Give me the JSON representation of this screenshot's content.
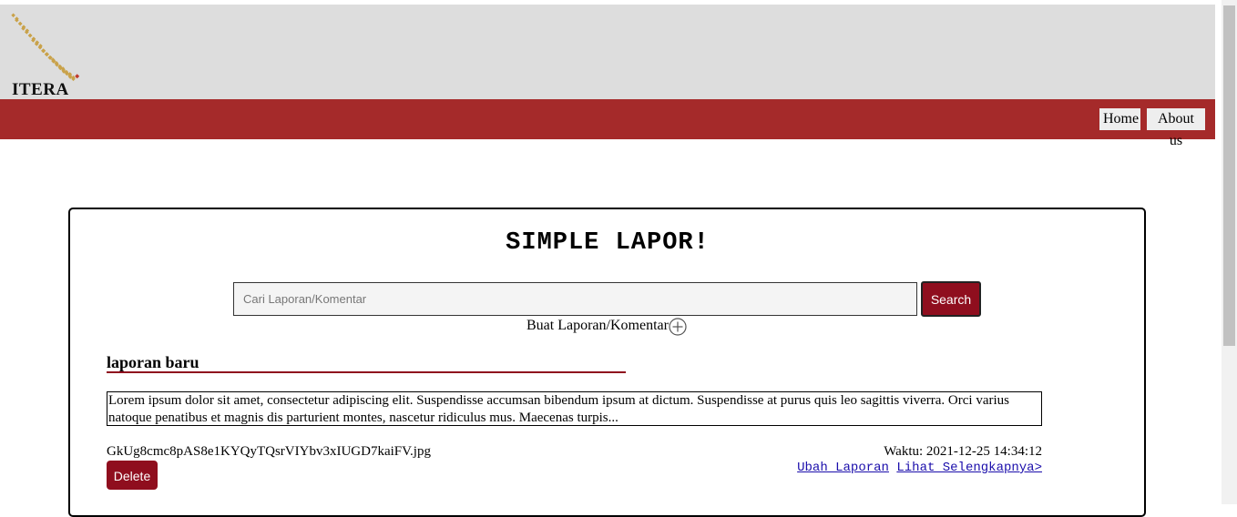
{
  "header": {
    "logo_text": "ITERA"
  },
  "nav": {
    "home": "Home",
    "about": "About us"
  },
  "main": {
    "title": "SIMPLE LAPOR!",
    "search": {
      "placeholder": "Cari Laporan/Komentar",
      "value": "",
      "button": "Search"
    },
    "create_link": "Buat Laporan/Komentar",
    "section_title": "laporan baru",
    "report": {
      "description": "Lorem ipsum dolor sit amet, consectetur adipiscing elit. Suspendisse accumsan bibendum ipsum at dictum. Suspendisse at purus quis leo sagittis viverra. Orci varius natoque penatibus et magnis dis parturient montes, nascetur ridiculus mus. Maecenas turpis...",
      "filename": "GkUg8cmc8pAS8e1KYQyTQsrVIYbv3xIUGD7kaiFV.jpg",
      "time": "Waktu: 2021-12-25 14:34:12",
      "delete_label": "Delete",
      "edit_link": "Ubah Laporan",
      "more_link": "Lihat Selengkapnya>"
    }
  },
  "colors": {
    "header_bg": "#dddddd",
    "nav_bg": "#a52a2a",
    "accent": "#8f0e1e",
    "logo_gold": "#c9a24a"
  }
}
